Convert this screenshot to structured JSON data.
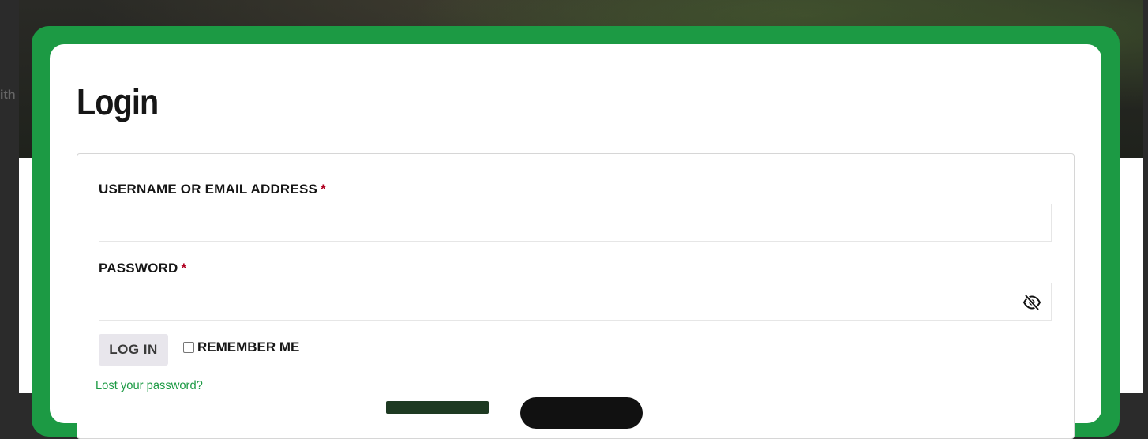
{
  "background": {
    "partial_text": "ith"
  },
  "modal": {
    "title": "Login",
    "username": {
      "label": "USERNAME OR EMAIL ADDRESS",
      "required_mark": "*",
      "value": "",
      "placeholder": ""
    },
    "password": {
      "label": "PASSWORD",
      "required_mark": "*",
      "value": "",
      "placeholder": "",
      "toggle_icon": "eye-slash-icon"
    },
    "login_button_label": "LOG IN",
    "remember_me": {
      "label": "REMEMBER ME",
      "checked": false
    },
    "lost_password_link": "Lost your password?"
  },
  "colors": {
    "accent_green": "#1c9a44",
    "required_red": "#b00020",
    "button_bg": "#e8e6ec"
  }
}
